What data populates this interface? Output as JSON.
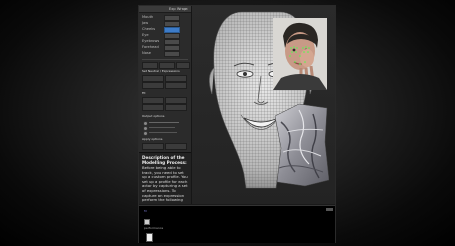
{
  "panel": {
    "title": "Exp Wrap",
    "close": "×",
    "rows": [
      {
        "label": "Mouth"
      },
      {
        "label": "Jaw"
      },
      {
        "label": "Cheeks",
        "selected": true
      },
      {
        "label": "Eye"
      },
      {
        "label": "Eyebrows"
      },
      {
        "label": "Forehead"
      },
      {
        "label": "Nose"
      }
    ],
    "section1": "Set Neutral / Expressions",
    "section2": "Fit",
    "section3": "Output options",
    "section4": "Apply options"
  },
  "description": {
    "title": "Description of the Modelling Process:",
    "body": "Before being able to track, you need to set up a custom profile. You set up a profile for each actor by capturing a set of expressions. To capture an expression perform the following"
  },
  "timeline": {
    "label": "M",
    "file": "performance"
  },
  "viewport": {
    "content": "3D wireframe head mesh, webcam video of actor, cloth scan"
  }
}
